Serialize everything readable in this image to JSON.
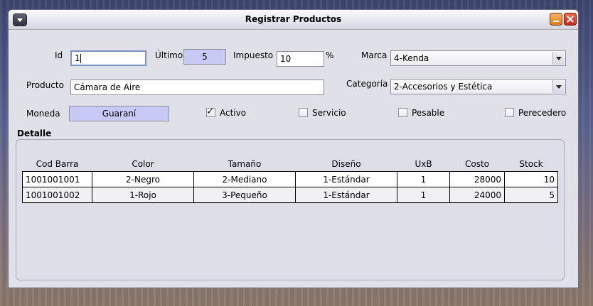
{
  "window": {
    "title": "Registrar Productos"
  },
  "form": {
    "id_label": "Id",
    "id_value": "1",
    "ultimo_label": "Último",
    "ultimo_value": "5",
    "impuesto_label": "Impuesto",
    "impuesto_value": "10",
    "percent": "%",
    "marca_label": "Marca",
    "marca_value": "4-Kenda",
    "producto_label": "Producto",
    "producto_value": "Cámara de Aire",
    "categoria_label": "Categoría",
    "categoria_value": "2-Accesorios y Estética",
    "moneda_label": "Moneda",
    "moneda_value": "Guaraní",
    "activo_label": "Activo",
    "activo_checked": true,
    "servicio_label": "Servicio",
    "servicio_checked": false,
    "pesable_label": "Pesable",
    "pesable_checked": false,
    "perecedero_label": "Perecedero",
    "perecedero_checked": false
  },
  "detalle": {
    "label": "Detalle",
    "columns": [
      "Cod Barra",
      "Color",
      "Tamaño",
      "Diseño",
      "UxB",
      "Costo",
      "Stock"
    ],
    "rows": [
      [
        "1001001001",
        "2-Negro",
        "2-Mediano",
        "1-Estándar",
        "1",
        "28000",
        "10"
      ],
      [
        "1001001002",
        "1-Rojo",
        "3-Pequeño",
        "1-Estándar",
        "1",
        "24000",
        "5"
      ]
    ]
  },
  "icons": {
    "sysmenu": "window-menu-icon",
    "minimize": "minimize-icon",
    "close": "close-icon",
    "dropdown": "chevron-down-icon",
    "check": "checkmark-icon"
  }
}
